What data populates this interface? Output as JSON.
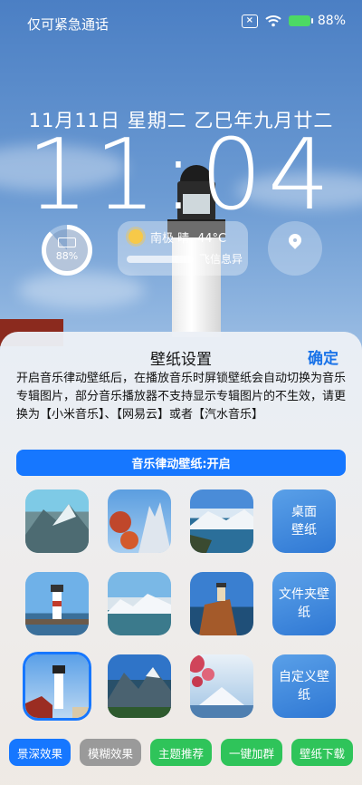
{
  "status": {
    "carrier": "仅可紧急通话",
    "battery": "88%"
  },
  "lockscreen": {
    "date": "11月11日 星期二 乙巳年九月廿二",
    "time": "11:04",
    "battery_widget_pct": "88%",
    "weather": {
      "location_condition": "南极 晴 -44°C",
      "message": "飞信息异"
    }
  },
  "sheet": {
    "title": "壁纸设置",
    "confirm": "确定",
    "description": "开启音乐律动壁纸后，在播放音乐时屏锁壁纸会自动切换为音乐专辑图片，部分音乐播放器不支持显示专辑图片的不生效，请更换为【小米音乐】、【网易云】或者【汽水音乐】",
    "toggle_label": "音乐律动壁纸:开启",
    "actions": {
      "desktop_wallpaper": "桌面壁纸",
      "folder_wallpaper": "文件夹壁纸",
      "custom_wallpaper": "自定义壁纸"
    },
    "bottom_buttons": [
      {
        "label": "景深效果",
        "color": "#1677ff"
      },
      {
        "label": "模糊效果",
        "color": "#9a9a9a"
      },
      {
        "label": "主题推荐",
        "color": "#2fc45a"
      },
      {
        "label": "一键加群",
        "color": "#2fc45a"
      },
      {
        "label": "壁纸下载",
        "color": "#2fc45a"
      }
    ]
  }
}
